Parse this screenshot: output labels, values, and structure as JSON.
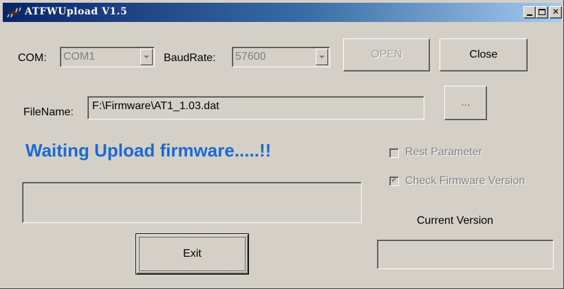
{
  "window": {
    "title": "ATFWUpload V1.5",
    "colors": {
      "face": "#d4d0c8",
      "title_start": "#0a246a",
      "title_end": "#a6caf0",
      "status": "#1a6ad1"
    }
  },
  "com": {
    "label": "COM:",
    "value": "COM1"
  },
  "baud": {
    "label": "BaudRate:",
    "value": "57600"
  },
  "buttons": {
    "open": "OPEN",
    "close": "Close",
    "browse": "...",
    "exit": "Exit"
  },
  "file": {
    "label": "FileName:",
    "value": "F:\\Firmware\\AT1_1.03.dat"
  },
  "status": {
    "text": "Waiting Upload firmware.....!!"
  },
  "options": {
    "rest_parameter": {
      "label": "Rest Parameter",
      "checked": false
    },
    "check_firmware": {
      "label": "Check Firmware Version",
      "checked": true
    }
  },
  "version": {
    "label": "Current Version",
    "value": ""
  },
  "progress": {
    "text": ""
  },
  "icons": {
    "app": "chip-icon",
    "min": "minimize-icon",
    "max": "maximize-icon",
    "close": "close-icon"
  }
}
